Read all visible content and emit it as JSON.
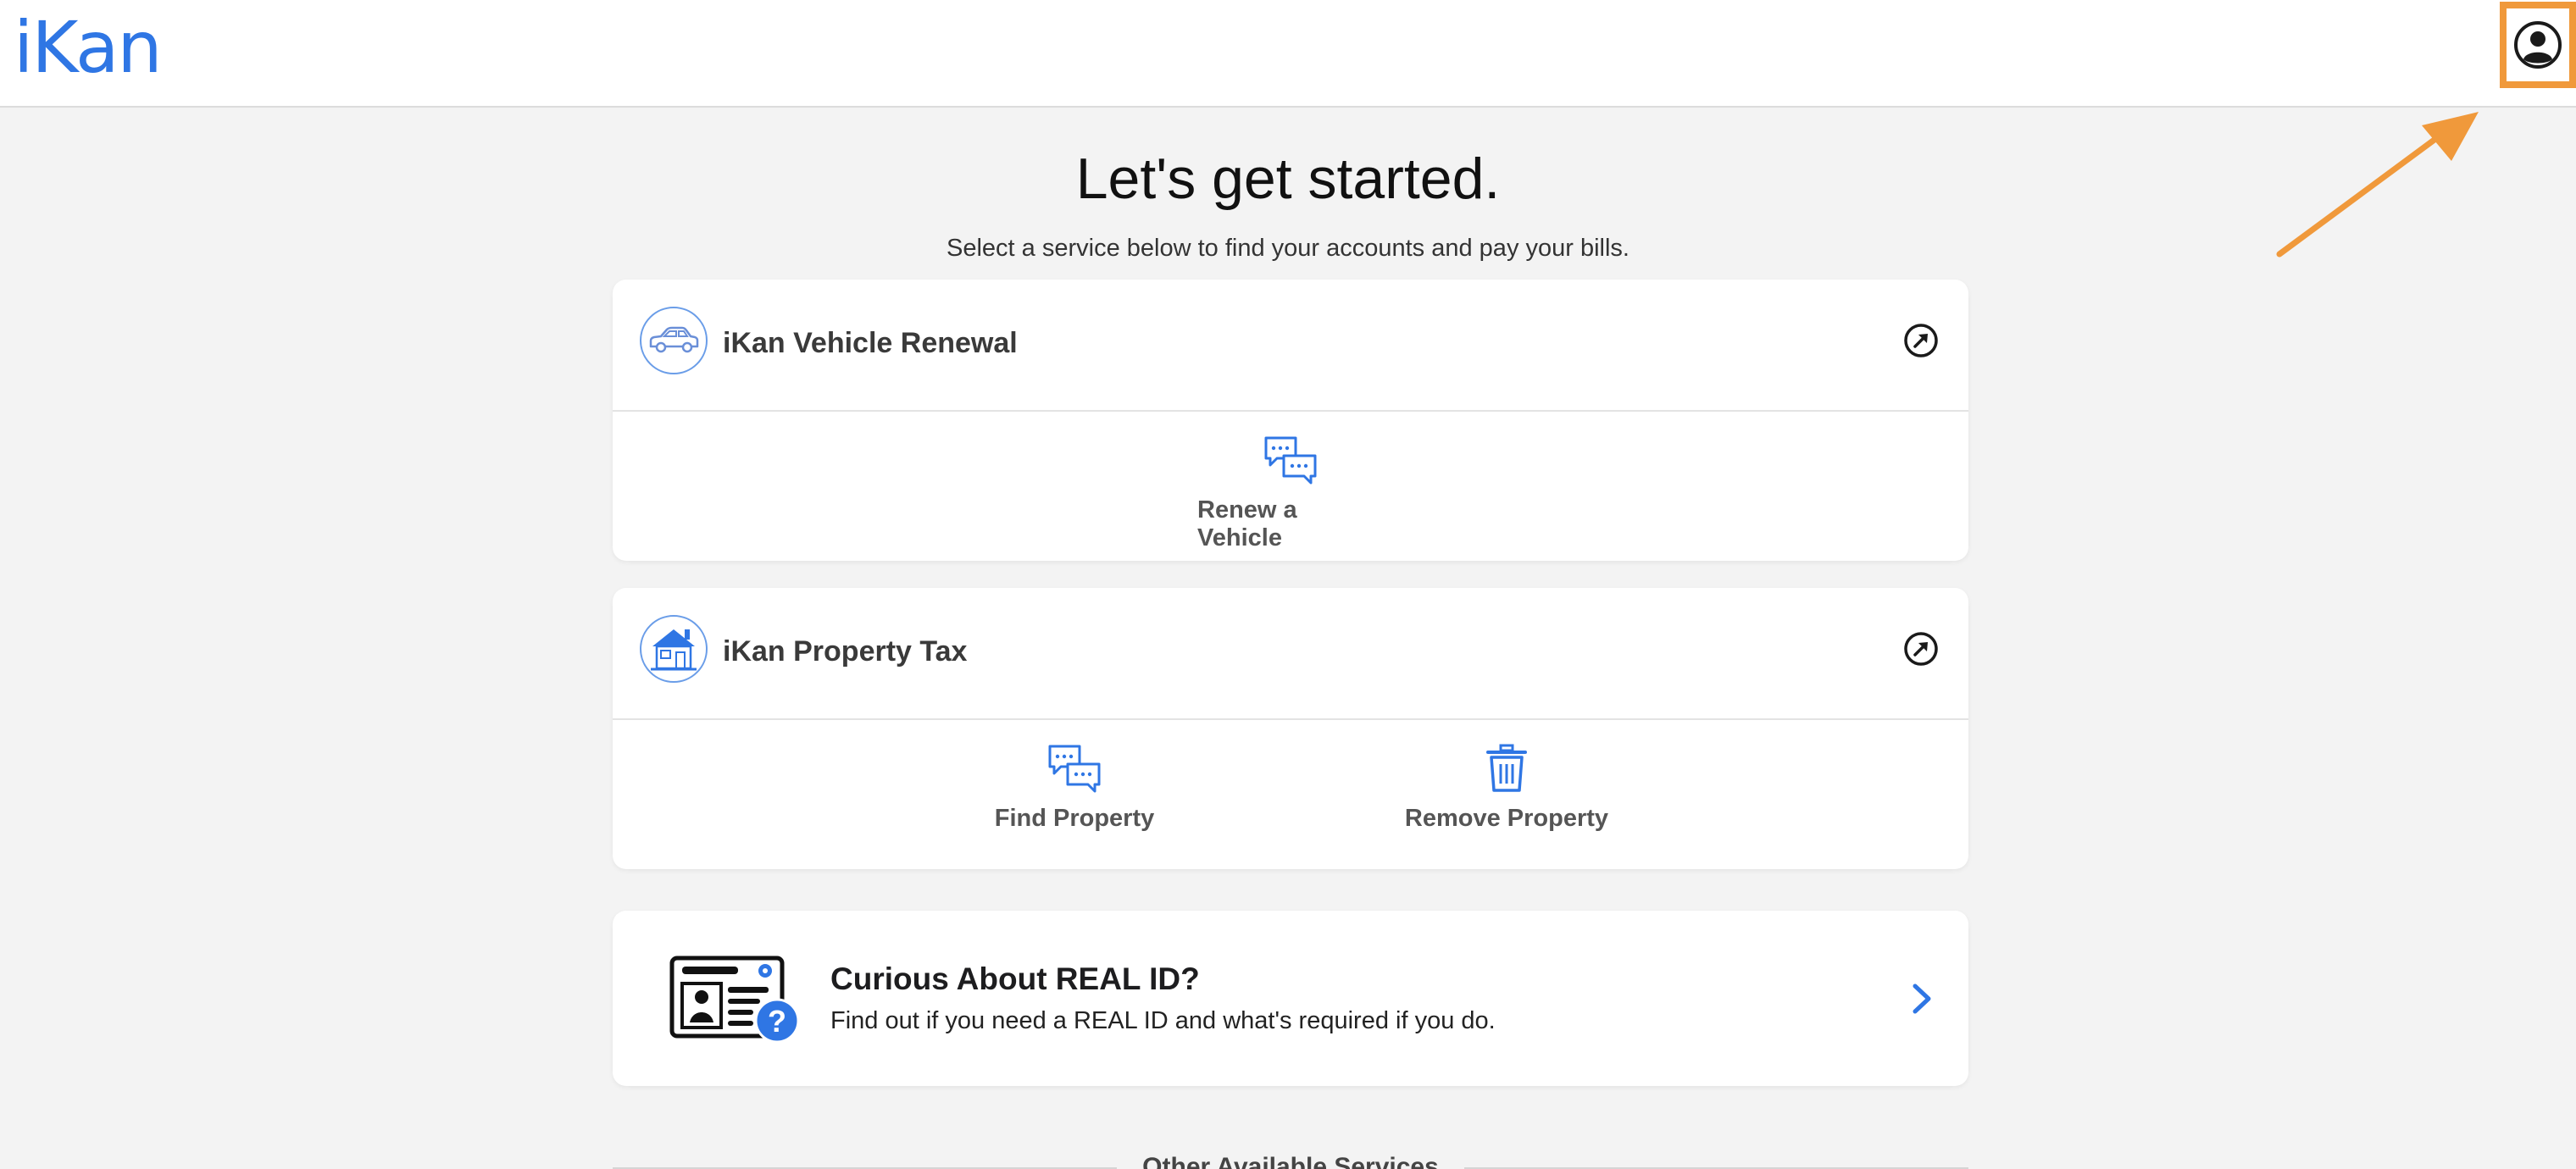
{
  "header": {
    "logo_text": "iKan",
    "profile_icon": "user-circle-icon",
    "accent": "#2f76e4",
    "highlight_color": "#f0993b"
  },
  "hero": {
    "title": "Let's get started.",
    "subtitle": "Select a service below to find your accounts and pay your bills."
  },
  "services": [
    {
      "title": "iKan Vehicle Renewal",
      "icon": "car-icon",
      "link_icon": "external-link-icon",
      "actions": [
        {
          "label": "Renew a Vehicle",
          "icon": "chat-bubbles-icon"
        }
      ]
    },
    {
      "title": "iKan Property Tax",
      "icon": "house-icon",
      "link_icon": "external-link-icon",
      "actions": [
        {
          "label": "Find Property",
          "icon": "chat-bubbles-icon"
        },
        {
          "label": "Remove Property",
          "icon": "trash-icon"
        }
      ]
    }
  ],
  "real_id": {
    "title": "Curious About REAL ID?",
    "description": "Find out if you need a REAL ID and what's required if you do.",
    "icon": "id-card-question-icon",
    "chevron_icon": "chevron-right-icon"
  },
  "other_services": {
    "label": "Other Available Services"
  }
}
